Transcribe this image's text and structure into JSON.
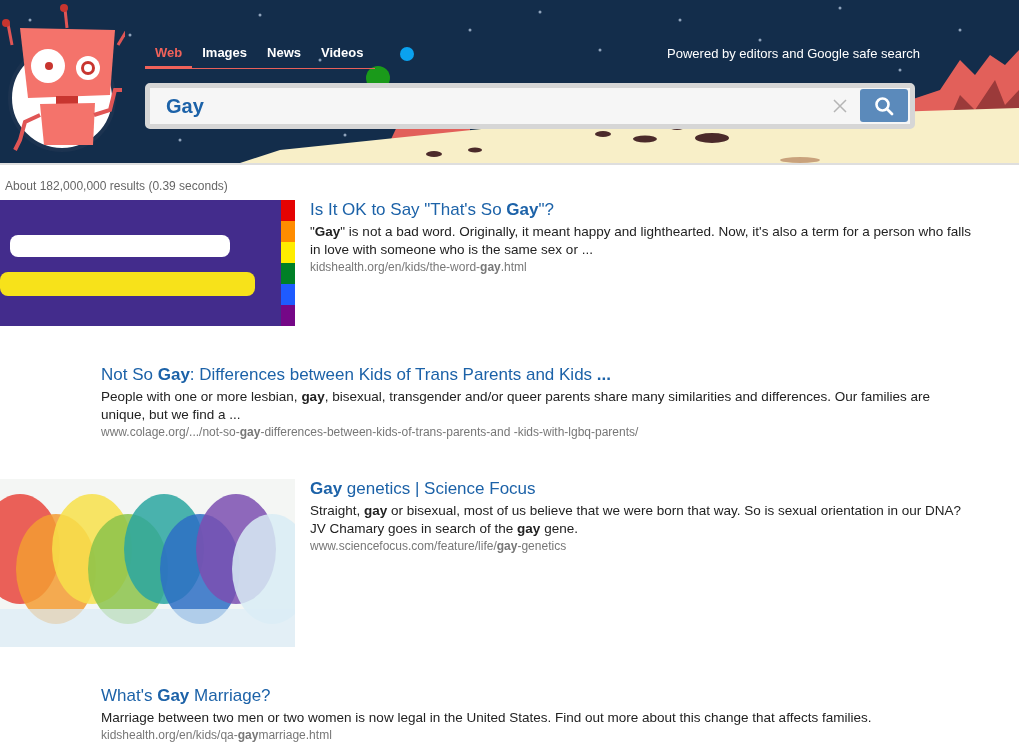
{
  "tabs": [
    {
      "label": "Web",
      "selected": true
    },
    {
      "label": "Images",
      "selected": false
    },
    {
      "label": "News",
      "selected": false
    },
    {
      "label": "Videos",
      "selected": false
    }
  ],
  "powered_by": "Powered by editors and Google safe search",
  "search": {
    "value": "Gay"
  },
  "result_stats": "About 182,000,000 results (0.39 seconds)",
  "results": [
    {
      "title": "Is It OK to Say \"That's So **Gay**\"?",
      "snippet": "\"**Gay**\" is not a bad word. Originally, it meant happy and lighthearted. Now, it's also a term for a person who falls in love with someone who is the same sex or ...",
      "url": "kidshealth.org/en/kids/the-word-**gay**.html"
    },
    {
      "kind": "text",
      "title": "Not So **Gay**: Differences between Kids of Trans Parents and Kids **...**",
      "snippet": "People with one or more lesbian, **gay**, bisexual, transgender and/or queer parents share many similarities and differences. Our families are unique, but we find a ...",
      "url": "www.colage.org/.../not-so-**gay**-differences-between-kids-of-trans-parents-and -kids-with-lgbq-parents/"
    },
    {
      "title": "**Gay** genetics | Science Focus",
      "snippet": "Straight, **gay** or bisexual, most of us believe that we were born that way. So is sexual orientation in our DNA? JV Chamary goes in search of the **gay** gene.",
      "url": "www.sciencefocus.com/feature/life/**gay**-genetics"
    },
    {
      "kind": "text",
      "title": "What's **Gay** Marriage?",
      "snippet": "Marriage between two men or two women is now legal in the United States. Find out more about this change that affects families.",
      "url": "kidshealth.org/en/kids/qa-**gay**marriage.html"
    }
  ]
}
